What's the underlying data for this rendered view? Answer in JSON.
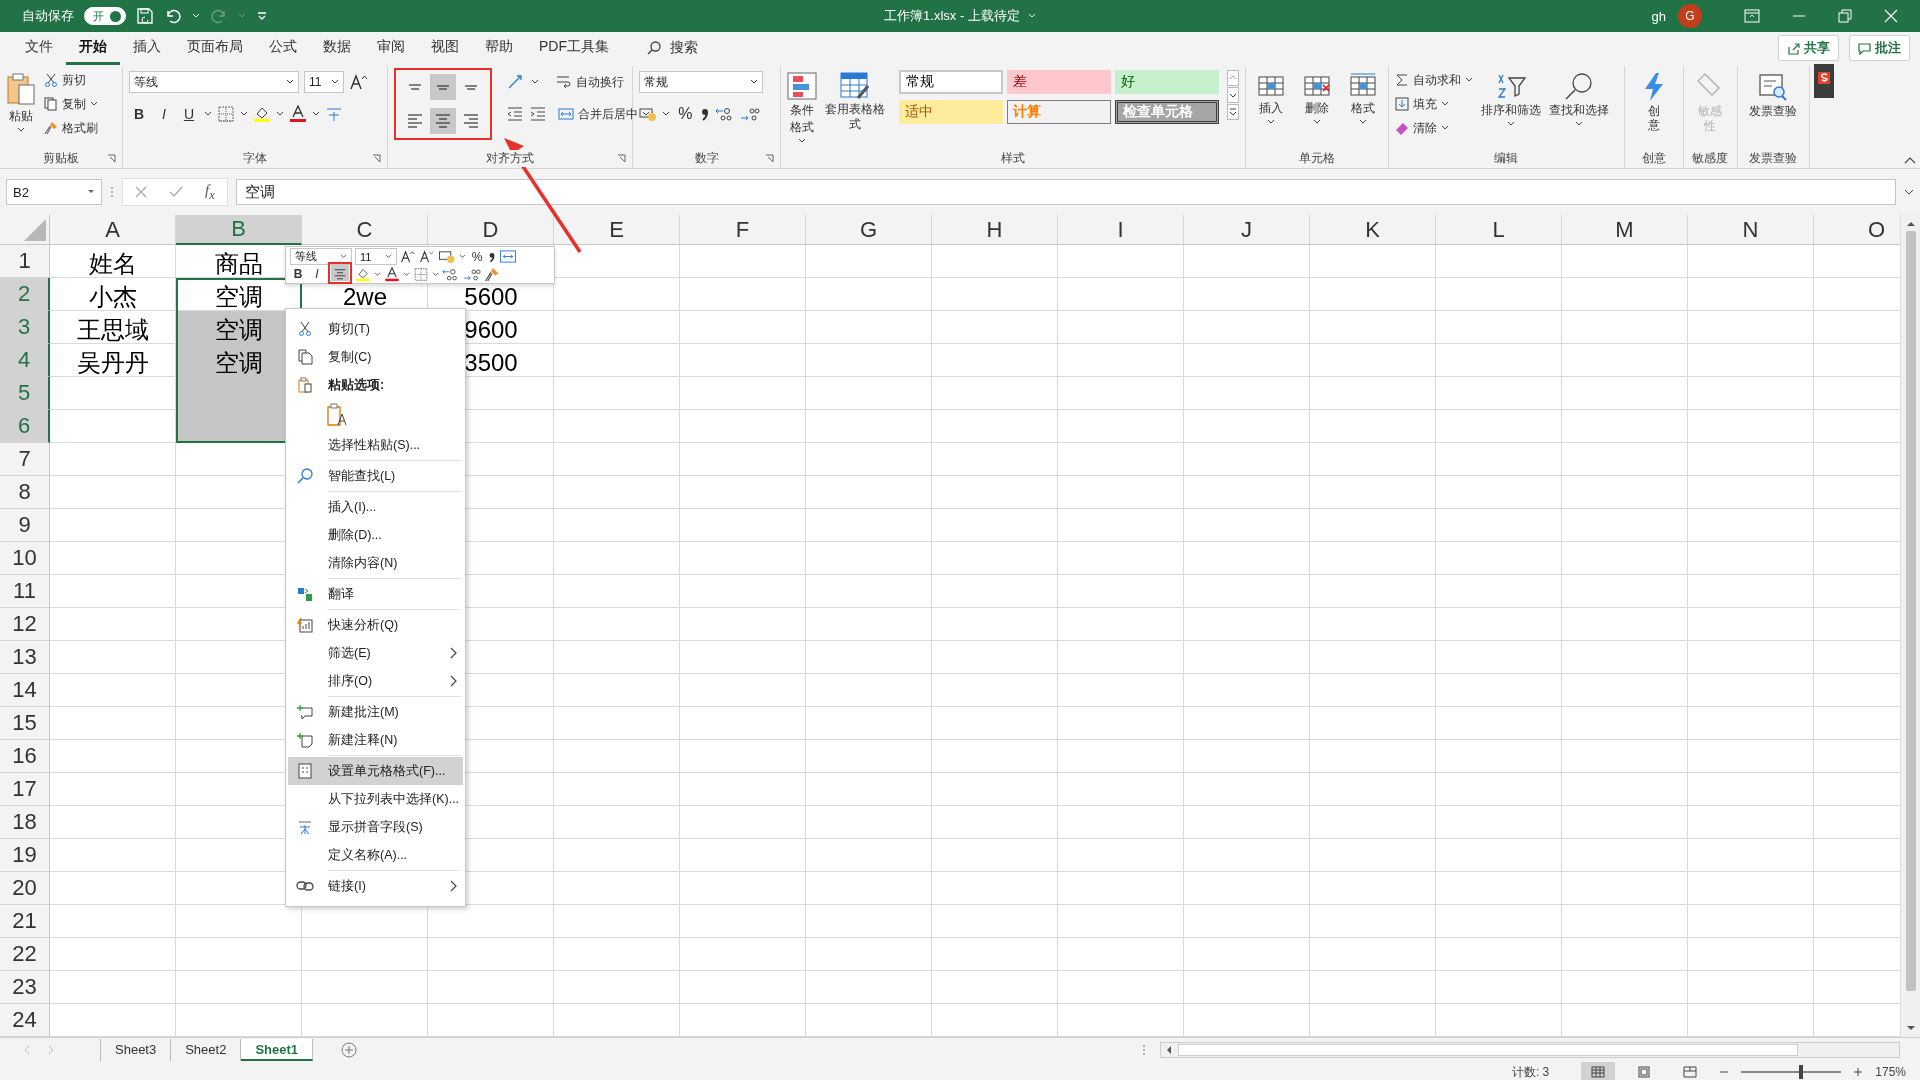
{
  "title_bar": {
    "autosave_label": "自动保存",
    "autosave_toggle": {
      "label": "开",
      "on": true
    },
    "title": "工作簿1.xlsx - 上载待定",
    "user": "gh",
    "avatar": "G"
  },
  "ribbon_tabs": [
    {
      "label": "文件",
      "selected": false
    },
    {
      "label": "开始",
      "selected": true
    },
    {
      "label": "插入",
      "selected": false
    },
    {
      "label": "页面布局",
      "selected": false
    },
    {
      "label": "公式",
      "selected": false
    },
    {
      "label": "数据",
      "selected": false
    },
    {
      "label": "审阅",
      "selected": false
    },
    {
      "label": "视图",
      "selected": false
    },
    {
      "label": "帮助",
      "selected": false
    },
    {
      "label": "PDF工具集",
      "selected": false
    }
  ],
  "search_label": "搜索",
  "share_button": "共享",
  "comments_button": "批注",
  "clipboard": {
    "paste": "粘贴",
    "cut": "剪切",
    "copy": "复制",
    "format_painter": "格式刷",
    "group_label": "剪贴板"
  },
  "font": {
    "font_name": "等线",
    "font_size": "11",
    "bold": "B",
    "italic": "I",
    "underline": "U",
    "group_label": "字体"
  },
  "alignment": {
    "buttons": [
      {
        "selected": false
      },
      {
        "selected": true
      },
      {
        "selected": false
      },
      {
        "selected": false
      },
      {
        "selected": true
      },
      {
        "selected": false
      }
    ],
    "wrap_text": "自动换行",
    "merge_center": "合并后居中",
    "group_label": "对齐方式"
  },
  "number": {
    "format": "常规",
    "percent": "%",
    "group_label": "数字"
  },
  "styles": {
    "conditional_formatting": "条件格式",
    "format_as_table": "套用表格格式",
    "cell_styles": [
      {
        "label": "常规",
        "kind": "normal"
      },
      {
        "label": "差",
        "kind": "bad"
      },
      {
        "label": "好",
        "kind": "good"
      },
      {
        "label": "适中",
        "kind": "neutral"
      },
      {
        "label": "计算",
        "kind": "calculation"
      },
      {
        "label": "检查单元格",
        "kind": "check"
      }
    ],
    "group_label": "样式"
  },
  "cells_group": {
    "insert": "插入",
    "delete": "删除",
    "format": "格式",
    "group_label": "单元格"
  },
  "editing": {
    "autosum": "自动求和",
    "fill": "填充",
    "clear": "清除",
    "sort_filter": "排序和筛选",
    "find_select": "查找和选择",
    "group_label": "编辑"
  },
  "ideas": {
    "label": "创意",
    "group_label": "创意"
  },
  "sensitivity": {
    "label": "敏感性",
    "disabled": true,
    "group_label": "敏感度"
  },
  "invoice": {
    "label": "发票查验",
    "group_label": "发票查验"
  },
  "formula_bar": {
    "name_box": "B2",
    "fx": "f$_{x}$",
    "value": "空调"
  },
  "sheet": {
    "columns": [
      {
        "label": "A",
        "selected": false
      },
      {
        "label": "B",
        "selected": true
      },
      {
        "label": "C",
        "selected": false
      },
      {
        "label": "D",
        "selected": false
      },
      {
        "label": "E",
        "selected": false
      },
      {
        "label": "F",
        "selected": false
      },
      {
        "label": "G",
        "selected": false
      },
      {
        "label": "H",
        "selected": false
      },
      {
        "label": "I",
        "selected": false
      },
      {
        "label": "J",
        "selected": false
      },
      {
        "label": "K",
        "selected": false
      },
      {
        "label": "L",
        "selected": false
      },
      {
        "label": "M",
        "selected": false
      },
      {
        "label": "N",
        "selected": false
      },
      {
        "label": "O",
        "selected": false
      }
    ],
    "rows": [
      {
        "label": "1",
        "selected": false,
        "cells": [
          {
            "text": "姓名",
            "selected": false
          },
          {
            "text": "商品",
            "selected": false
          }
        ]
      },
      {
        "label": "2",
        "selected": true,
        "cells": [
          {
            "text": "小杰",
            "selected": false
          },
          {
            "text": "空调",
            "selected": true,
            "active": true
          },
          {
            "text": "2we",
            "selected": false
          },
          {
            "text": "5600",
            "selected": false
          }
        ]
      },
      {
        "label": "3",
        "selected": true,
        "cells": [
          {
            "text": "王思域",
            "selected": false
          },
          {
            "text": "空调",
            "selected": true,
            "active": false
          },
          null,
          {
            "text": "9600",
            "selected": false
          }
        ]
      },
      {
        "label": "4",
        "selected": true,
        "cells": [
          {
            "text": "吴丹丹",
            "selected": false
          },
          {
            "text": "空调",
            "selected": true,
            "active": false
          },
          null,
          {
            "text": "3500",
            "selected": false
          }
        ]
      },
      {
        "label": "5",
        "selected": true,
        "cells": [
          null,
          {
            "selected": true,
            "active": false
          }
        ]
      },
      {
        "label": "6",
        "selected": true,
        "cells": [
          null,
          {
            "selected": true,
            "active": false
          }
        ]
      },
      {
        "label": "7",
        "selected": false
      },
      {
        "label": "8",
        "selected": false
      },
      {
        "label": "9",
        "selected": false
      },
      {
        "label": "10",
        "selected": false
      },
      {
        "label": "11",
        "selected": false
      },
      {
        "label": "12",
        "selected": false
      },
      {
        "label": "13",
        "selected": false
      },
      {
        "label": "14",
        "selected": false
      },
      {
        "label": "15",
        "selected": false
      },
      {
        "label": "16",
        "selected": false
      },
      {
        "label": "17",
        "selected": false
      },
      {
        "label": "18",
        "selected": false
      },
      {
        "label": "19",
        "selected": false
      },
      {
        "label": "20",
        "selected": false
      },
      {
        "label": "21",
        "selected": false
      },
      {
        "label": "22",
        "selected": false
      },
      {
        "label": "23",
        "selected": false
      },
      {
        "label": "24",
        "selected": false
      }
    ]
  },
  "mini_toolbar": {
    "font_name": "等线",
    "font_size": "11",
    "percent": "%",
    "bold": "B",
    "italic": "I",
    "center_selected": true
  },
  "context_menu": [
    {
      "kind": "item",
      "label": "剪切(T)",
      "selected": false
    },
    {
      "kind": "item",
      "label": "复制(C)",
      "selected": false
    },
    {
      "kind": "header",
      "label": "粘贴选项:"
    },
    {
      "kind": "paste-options"
    },
    {
      "kind": "item",
      "label": "选择性粘贴(S)...",
      "selected": false
    },
    {
      "kind": "separator"
    },
    {
      "kind": "item",
      "label": "智能查找(L)",
      "selected": false
    },
    {
      "kind": "separator"
    },
    {
      "kind": "item",
      "label": "插入(I)...",
      "selected": false
    },
    {
      "kind": "item",
      "label": "删除(D)...",
      "selected": false
    },
    {
      "kind": "item",
      "label": "清除内容(N)",
      "selected": false
    },
    {
      "kind": "separator"
    },
    {
      "kind": "item",
      "label": "翻译",
      "selected": false
    },
    {
      "kind": "separator"
    },
    {
      "kind": "item",
      "label": "快速分析(Q)",
      "selected": false
    },
    {
      "kind": "submenu",
      "label": "筛选(E)",
      "selected": false
    },
    {
      "kind": "submenu",
      "label": "排序(O)",
      "selected": false
    },
    {
      "kind": "separator"
    },
    {
      "kind": "item",
      "label": "新建批注(M)",
      "selected": false
    },
    {
      "kind": "item",
      "label": "新建注释(N)",
      "selected": false
    },
    {
      "kind": "separator"
    },
    {
      "kind": "item",
      "label": "设置单元格格式(F)...",
      "selected": true
    },
    {
      "kind": "item",
      "label": "从下拉列表中选择(K)...",
      "selected": false
    },
    {
      "kind": "item",
      "label": "显示拼音字段(S)",
      "selected": false
    },
    {
      "kind": "item",
      "label": "定义名称(A)...",
      "selected": false
    },
    {
      "kind": "separator"
    },
    {
      "kind": "submenu",
      "label": "链接(I)",
      "selected": false
    }
  ],
  "sheet_tabs": [
    {
      "label": "Sheet3",
      "selected": false
    },
    {
      "label": "Sheet2",
      "selected": false
    },
    {
      "label": "Sheet1",
      "selected": true
    }
  ],
  "status_bar": {
    "count": "计数: 3",
    "views": [
      {
        "selected": true
      },
      {
        "selected": false
      },
      {
        "selected": false
      }
    ],
    "zoom": {
      "label": "175%",
      "level": 0.6
    }
  }
}
